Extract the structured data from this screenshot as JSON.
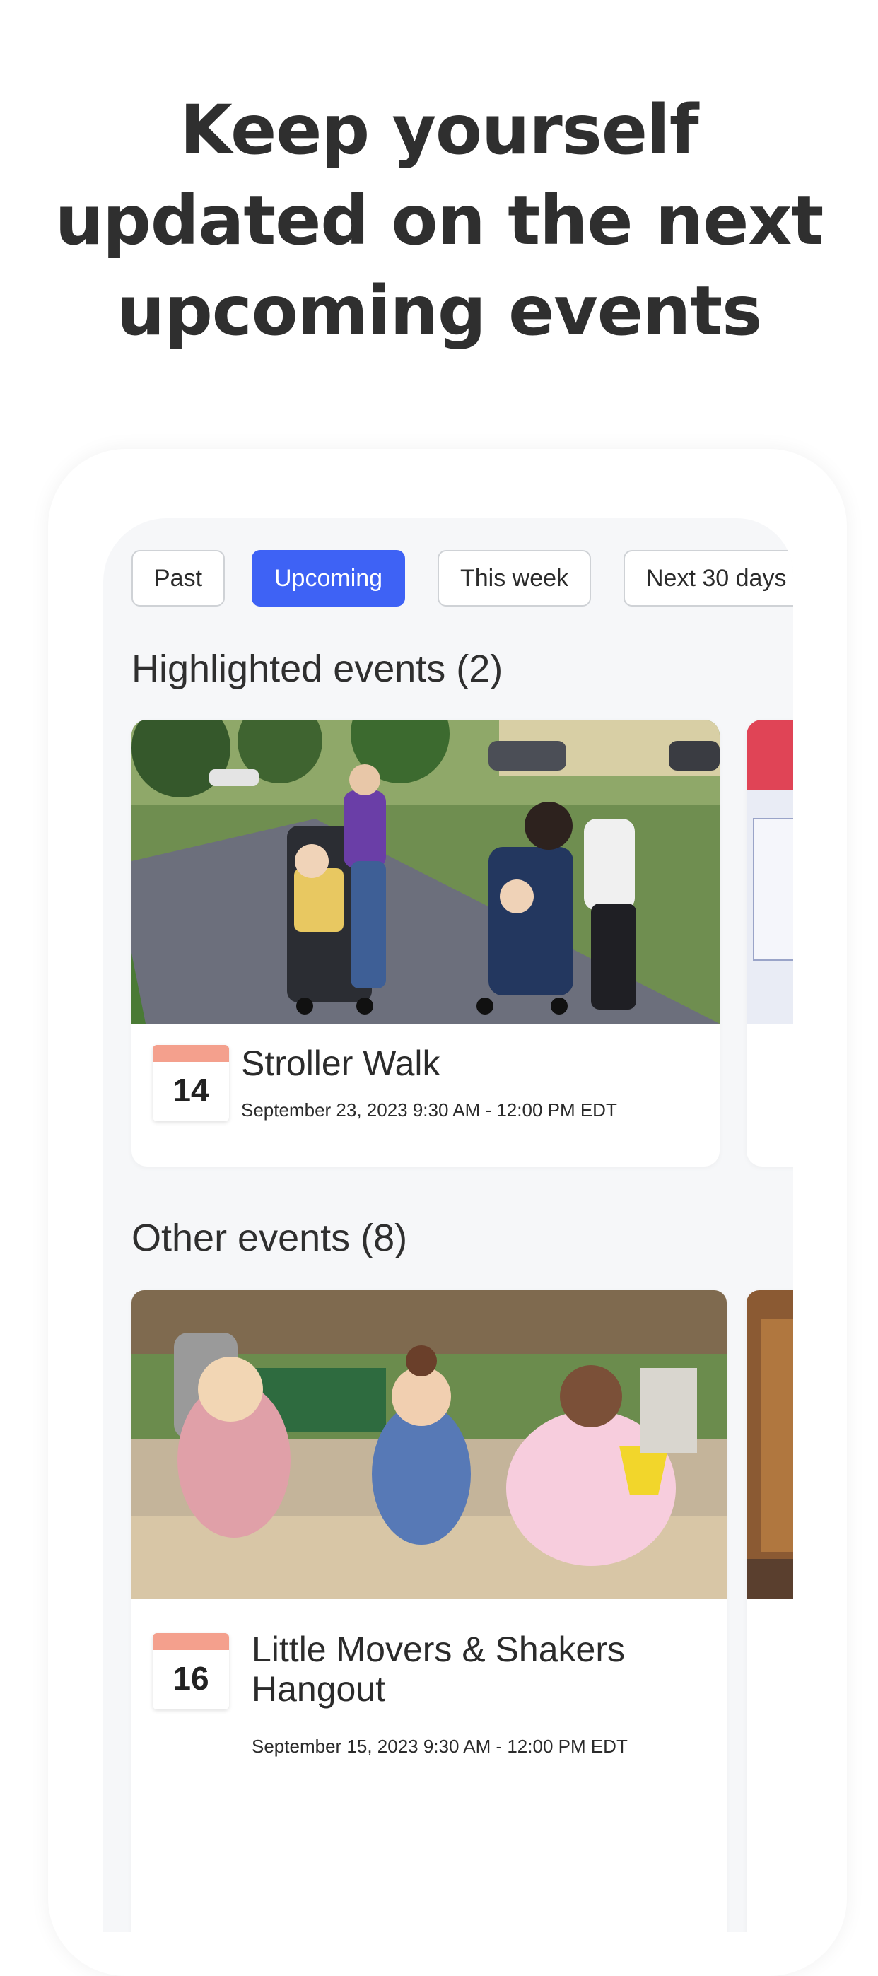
{
  "headline": {
    "line1": "Keep yourself",
    "line2": "updated on the next",
    "line3": "upcoming events"
  },
  "filters": [
    {
      "label": "Past",
      "active": false
    },
    {
      "label": "Upcoming",
      "active": true
    },
    {
      "label": "This week",
      "active": false
    },
    {
      "label": "Next 30 days",
      "active": false
    }
  ],
  "highlighted": {
    "title": "Highlighted events (2)",
    "events": [
      {
        "day": "14",
        "title": "Stroller Walk",
        "date": "September 23, 2023 9:30 AM - 12:00 PM EDT"
      }
    ]
  },
  "other": {
    "title": "Other events (8)",
    "events": [
      {
        "day": "16",
        "title_line1": "Little Movers & Shakers",
        "title_line2": "Hangout",
        "date": "September 15, 2023 9:30 AM - 12:00 PM EDT"
      }
    ]
  },
  "colors": {
    "accent": "#3e62f5",
    "calendar_header": "#f4a08d",
    "screen_bg": "#f6f7f9"
  }
}
